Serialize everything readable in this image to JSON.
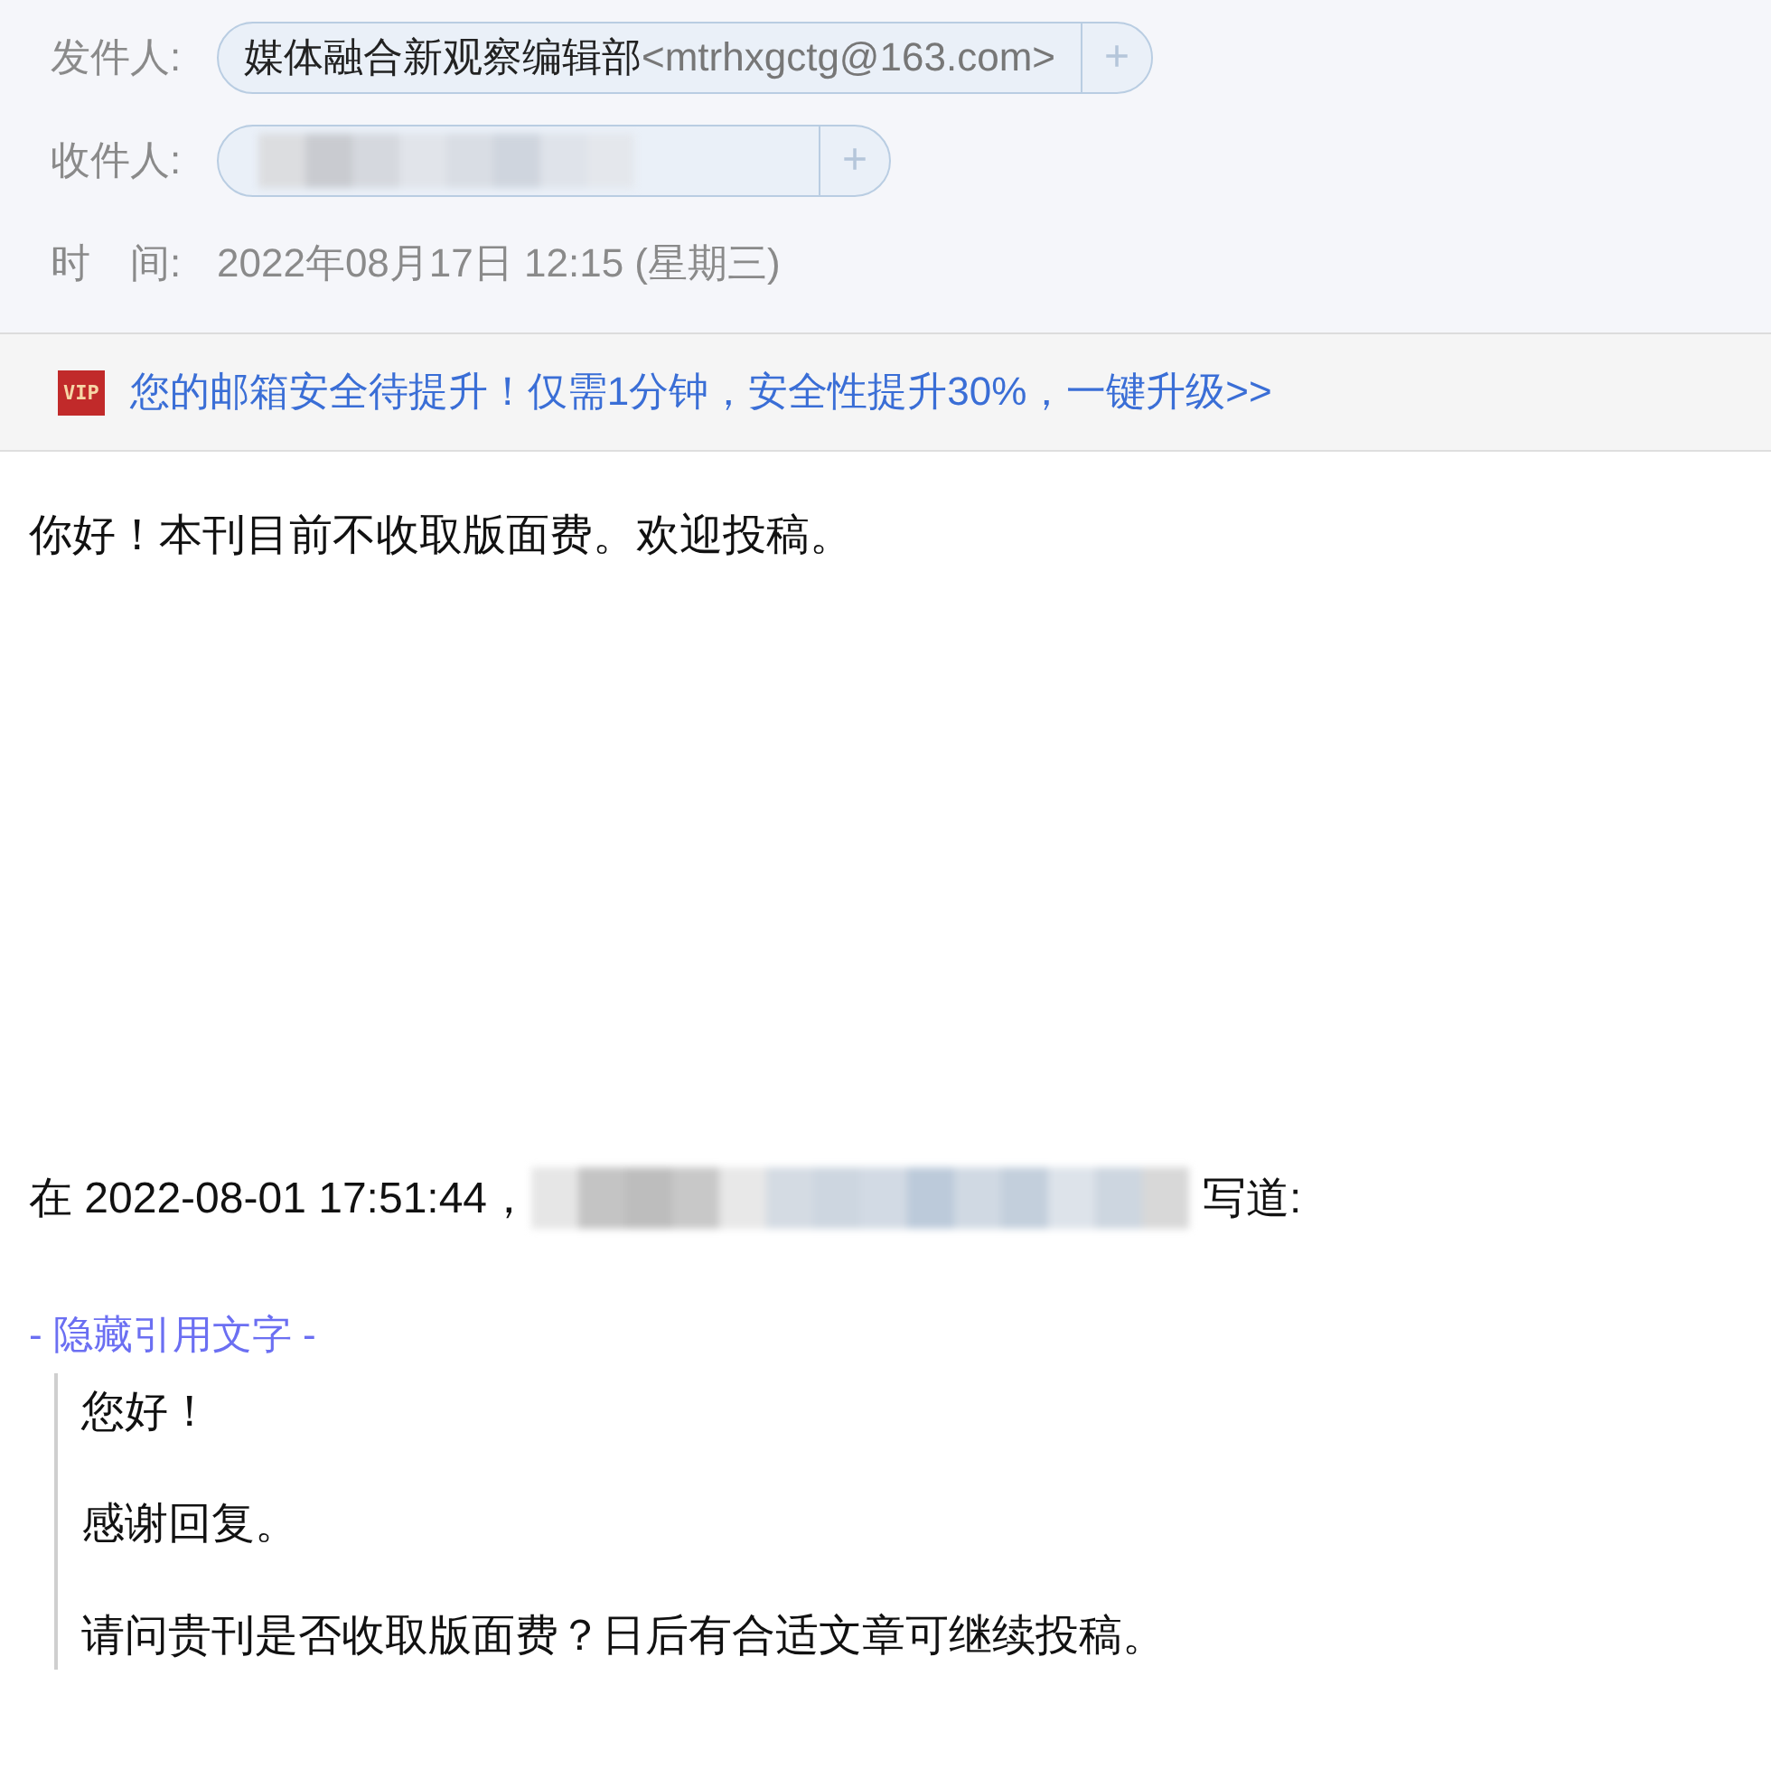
{
  "header": {
    "sender": {
      "label": "发件人:",
      "name": "媒体融合新观察编辑部",
      "address": "<mtrhxgctg@163.com>",
      "add": "+"
    },
    "recipient": {
      "label": "收件人:",
      "add": "+"
    },
    "time": {
      "label_1": "时",
      "label_2": "间:",
      "value": "2022年08月17日 12:15 (星期三)"
    }
  },
  "notice": {
    "badge": "VIP",
    "text": "您的邮箱安全待提升！仅需1分钟，安全性提升30%，一键升级>>"
  },
  "body": {
    "greeting": "你好！本刊目前不收取版面费。欢迎投稿。",
    "quote_intro_1": "在 2022-08-01 17:51:44，",
    "quote_intro_2": "写道:",
    "toggle": "- 隐藏引用文字 -",
    "quoted": [
      "您好！",
      "感谢回复。",
      "请问贵刊是否收取版面费？日后有合适文章可继续投稿。"
    ]
  }
}
